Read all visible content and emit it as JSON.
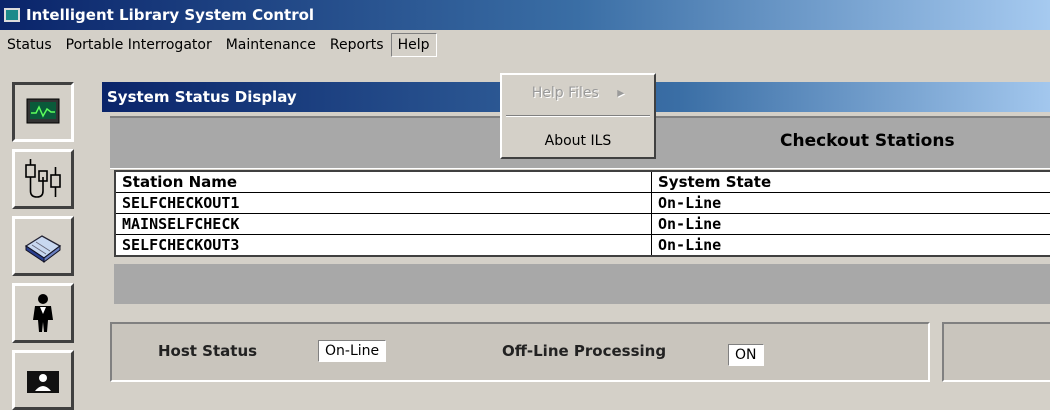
{
  "window": {
    "title": "Intelligent Library System Control"
  },
  "menu": {
    "items": [
      "Status",
      "Portable Interrogator",
      "Maintenance",
      "Reports",
      "Help"
    ],
    "open_index": 4
  },
  "help_menu": {
    "items": [
      {
        "label": "Help Files",
        "disabled": true,
        "submenu": true
      },
      {
        "label": "About ILS",
        "disabled": false,
        "submenu": false
      }
    ]
  },
  "toolbar": {
    "buttons": [
      {
        "icon": "monitor-graph-icon",
        "pressed": true
      },
      {
        "icon": "connectors-icon",
        "pressed": false
      },
      {
        "icon": "book-icon",
        "pressed": false
      },
      {
        "icon": "person-icon",
        "pressed": false
      },
      {
        "icon": "user-card-icon",
        "pressed": false
      }
    ]
  },
  "status_window": {
    "title": "System Status Display",
    "section_title": "Checkout Stations",
    "table": {
      "headers": [
        "Station Name",
        "System State"
      ],
      "rows": [
        [
          "SELFCHECKOUT1",
          "On-Line"
        ],
        [
          "MAINSELFCHECK",
          "On-Line"
        ],
        [
          "SELFCHECKOUT3",
          "On-Line"
        ]
      ]
    },
    "host_status_label": "Host Status",
    "host_status_value": "On-Line",
    "offline_label": "Off-Line Processing",
    "offline_value": "ON"
  },
  "colors": {
    "title_bar": "#0a246a",
    "face": "#d4d0c8",
    "dark_panel": "#a8a8a8"
  }
}
